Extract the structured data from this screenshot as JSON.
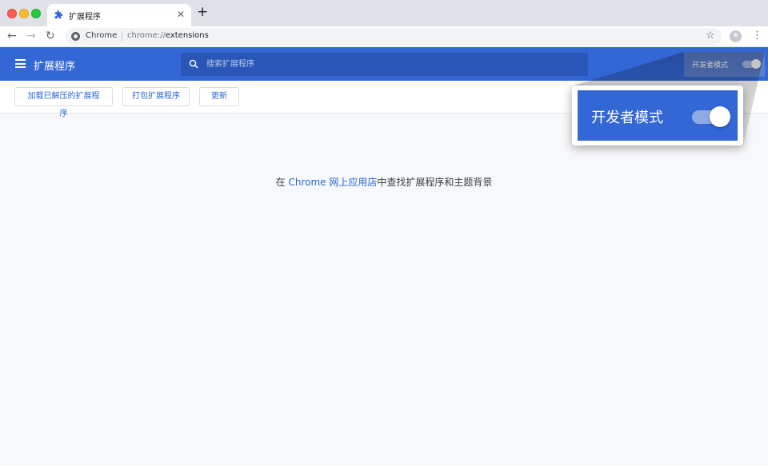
{
  "window": {
    "tab_title": "扩展程序",
    "new_tab_label": "+",
    "tab_close_label": "✕"
  },
  "toolbar": {
    "back_label": "←",
    "forward_label": "→",
    "reload_label": "↻",
    "omnibox_chip": "Chrome",
    "url_scheme": "chrome://",
    "url_path": "extensions",
    "star_label": "☆",
    "menu_label": "⋮"
  },
  "header": {
    "title": "扩展程序",
    "search_placeholder": "搜索扩展程序",
    "search_value": "",
    "dev_mode_label": "开发者模式",
    "dev_mode_enabled": true
  },
  "actions": {
    "load_unpacked": "加载已解压的扩展程序",
    "pack": "打包扩展程序",
    "update": "更新"
  },
  "callout": {
    "label": "开发者模式",
    "enabled": true
  },
  "main": {
    "msg_prefix": "在 ",
    "store_link": "Chrome 网上应用店",
    "msg_suffix": "中查找扩展程序和主题背景"
  },
  "colors": {
    "header_blue": "#3367d6",
    "link_blue": "#2a66d2",
    "page_bg": "#f7f8fa"
  },
  "icons": [
    "puzzle-icon",
    "hamburger-icon",
    "search-icon",
    "site-info-icon",
    "star-icon",
    "profile-icon",
    "menu-icon"
  ]
}
